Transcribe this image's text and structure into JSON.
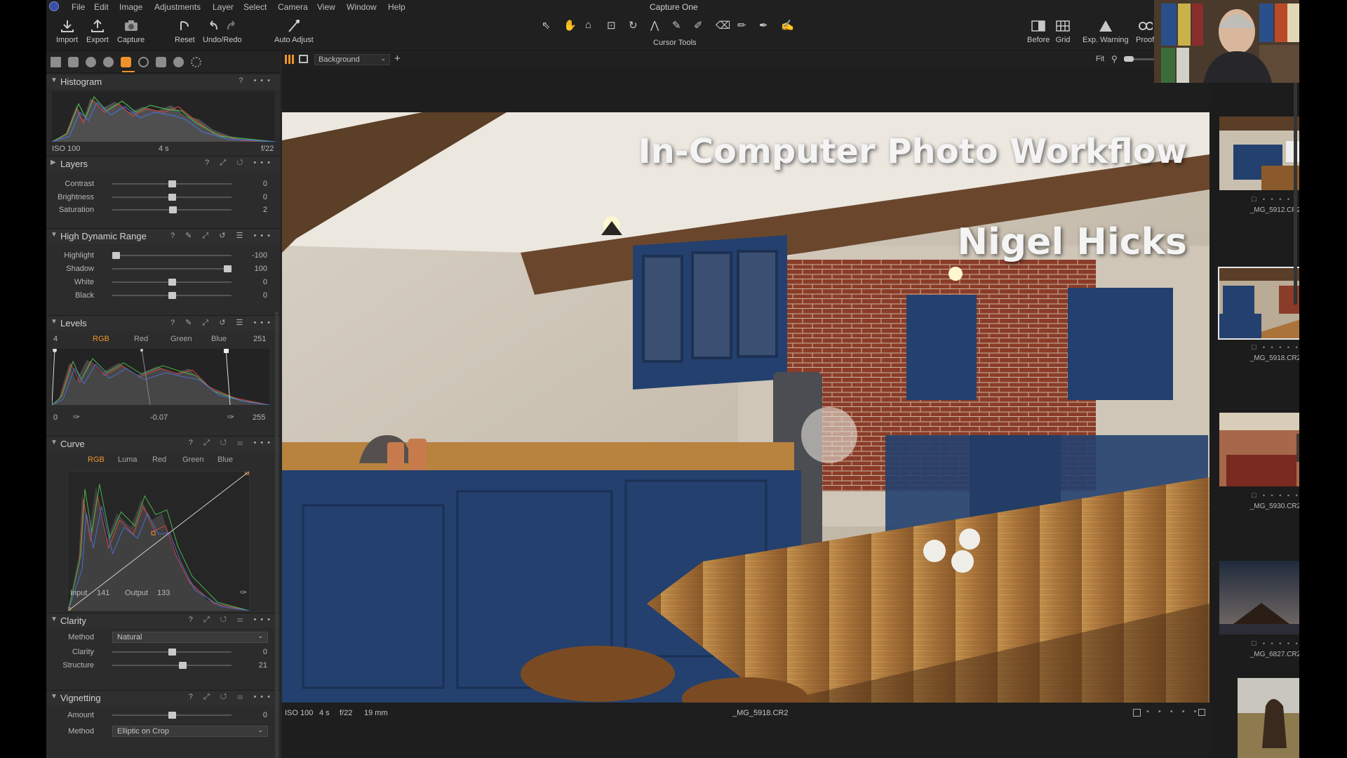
{
  "app": {
    "title": "Capture One"
  },
  "menu": [
    "File",
    "Edit",
    "Image",
    "Adjustments",
    "Layer",
    "Select",
    "Camera",
    "View",
    "Window",
    "Help"
  ],
  "toolbar": {
    "left": [
      {
        "label": "Import",
        "icon": "import-icon"
      },
      {
        "label": "Export",
        "icon": "export-icon"
      },
      {
        "label": "Capture",
        "icon": "camera-icon"
      },
      {
        "label": "Reset",
        "icon": "reset-icon"
      },
      {
        "label": "Undo/Redo",
        "icon": "undo-redo-icon"
      },
      {
        "label": "Auto Adjust",
        "icon": "auto-adjust-icon"
      }
    ],
    "cursor_tools_label": "Cursor Tools",
    "right": [
      {
        "label": "Before",
        "icon": "before-icon"
      },
      {
        "label": "Grid",
        "icon": "grid-icon"
      },
      {
        "label": "Exp. Warning",
        "icon": "warning-icon"
      },
      {
        "label": "Proof",
        "icon": "proof-icon"
      }
    ]
  },
  "histogram": {
    "title": "Histogram",
    "iso": "ISO 100",
    "shutter": "4 s",
    "aperture": "f/22",
    "help": "?",
    "more": "•••"
  },
  "layers": {
    "title": "Layers",
    "sliders": [
      {
        "label": "Contrast",
        "value": "0",
        "pos": 0.5
      },
      {
        "label": "Brightness",
        "value": "0",
        "pos": 0.5
      },
      {
        "label": "Saturation",
        "value": "2",
        "pos": 0.51
      }
    ]
  },
  "hdr": {
    "title": "High Dynamic Range",
    "sliders": [
      {
        "label": "Highlight",
        "value": "-100",
        "pos": 0.0
      },
      {
        "label": "Shadow",
        "value": "100",
        "pos": 1.0
      },
      {
        "label": "White",
        "value": "0",
        "pos": 0.5
      },
      {
        "label": "Black",
        "value": "0",
        "pos": 0.5
      }
    ]
  },
  "levels": {
    "title": "Levels",
    "left_num": "4",
    "right_num": "251",
    "channels": [
      "RGB",
      "Red",
      "Green",
      "Blue"
    ],
    "active_channel": "RGB",
    "low": "0",
    "mid": "-0.07",
    "high": "255"
  },
  "curve": {
    "title": "Curve",
    "channels": [
      "RGB",
      "Luma",
      "Red",
      "Green",
      "Blue"
    ],
    "active_channel": "RGB",
    "input_label": "Input",
    "input_value": "141",
    "output_label": "Output",
    "output_value": "133"
  },
  "clarity": {
    "title": "Clarity",
    "method_label": "Method",
    "method_value": "Natural",
    "sliders": [
      {
        "label": "Clarity",
        "value": "0",
        "pos": 0.5
      },
      {
        "label": "Structure",
        "value": "21",
        "pos": 0.6
      }
    ]
  },
  "vignetting": {
    "title": "Vignetting",
    "sliders": [
      {
        "label": "Amount",
        "value": "0",
        "pos": 0.5
      }
    ],
    "method_label": "Method",
    "method_value": "Elliptic on Crop"
  },
  "viewer": {
    "variant": "Background",
    "fit": "Fit",
    "overlay_title": "In-Computer Photo Workflow",
    "overlay_author": "Nigel Hicks",
    "info": {
      "iso": "ISO 100",
      "shutter": "4 s",
      "aperture": "f/22",
      "focal": "19 mm",
      "filename": "_MG_5918.CR2"
    }
  },
  "browser": {
    "items": [
      {
        "name": "_MG_5912.CR2",
        "selected": false
      },
      {
        "name": "_MG_5918.CR2",
        "selected": true
      },
      {
        "name": "_MG_5930.CR2",
        "selected": false
      },
      {
        "name": "_MG_6827.CR2",
        "selected": false
      },
      {
        "name": "",
        "selected": false
      }
    ]
  },
  "colors": {
    "accent": "#f0922c",
    "panel": "#2c2c2c",
    "menubar": "#202020",
    "cabinet_blue": "#24406e",
    "brick": "#8a3a26",
    "wood": "#b27a3a"
  }
}
